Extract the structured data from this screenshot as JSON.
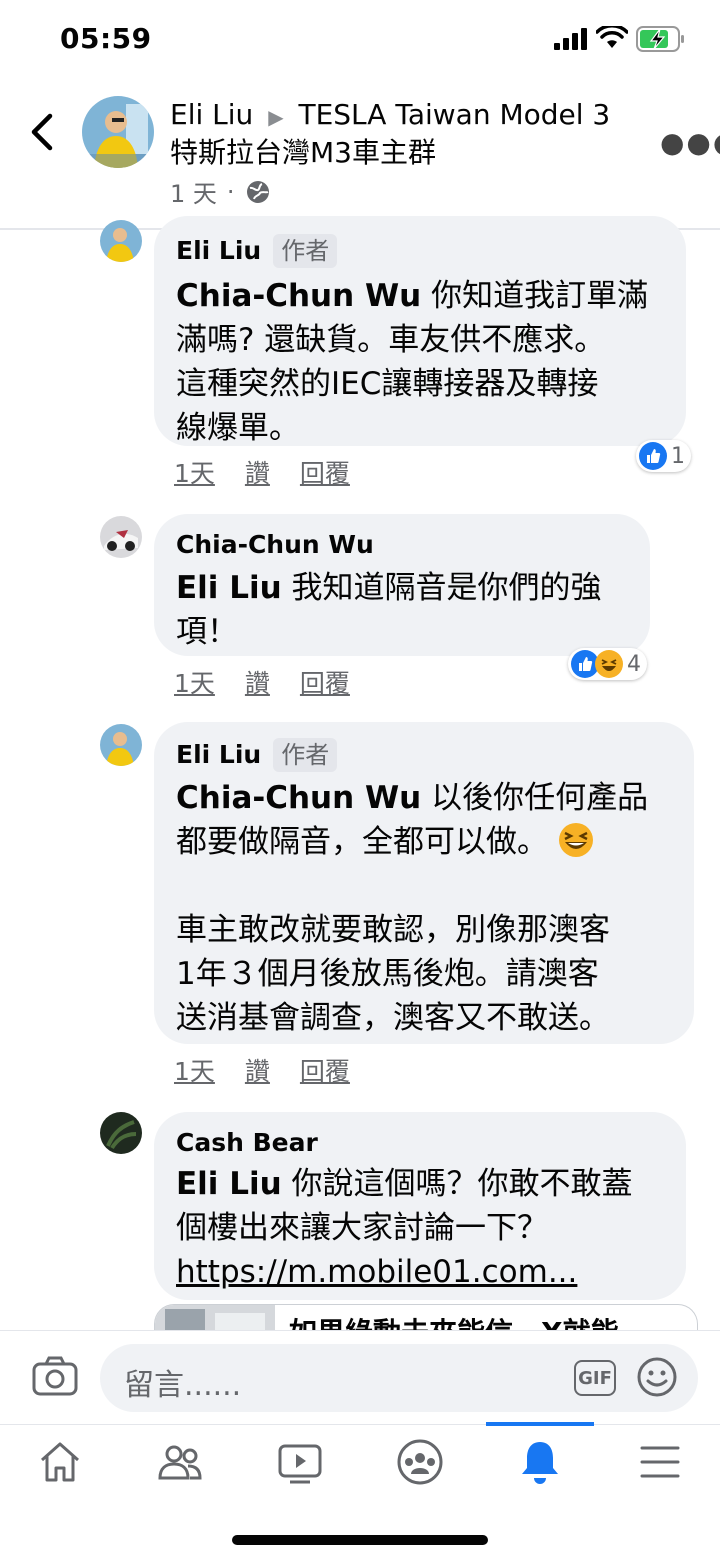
{
  "status_bar": {
    "time": "05:59"
  },
  "header": {
    "poster": "Eli Liu",
    "group_line1": "TESLA Taiwan Model 3",
    "group_line2": "特斯拉台灣M3車主群",
    "time": "1 天",
    "separator": "·"
  },
  "comments": [
    {
      "name": "Eli Liu",
      "badge": "作者",
      "mention": "Chia-Chun Wu",
      "text_l1": "你知道我訂單滿",
      "text_l2": "滿嗎? 還缺貨。車友供不應求。",
      "text_l3": "這種突然的IEC讓轉接器及轉接",
      "text_l4": "線爆單。",
      "time": "1天",
      "like": "讚",
      "reply": "回覆",
      "reaction_count": "1"
    },
    {
      "name": "Chia-Chun Wu",
      "mention": "Eli Liu",
      "text_l1": "我知道隔音是你們的強",
      "text_l2": "項！",
      "time": "1天",
      "like": "讚",
      "reply": "回覆",
      "reaction_count": "4"
    },
    {
      "name": "Eli Liu",
      "badge": "作者",
      "mention": "Chia-Chun Wu",
      "text_l1": "以後你任何產品",
      "text_l2": "都要做隔音，全都可以做。",
      "text_l3": "車主敢改就要敢認，別像那澳客",
      "text_l4": "1年３個月後放馬後炮。請澳客",
      "text_l5": "送消基會調查，澳客又不敢送。",
      "time": "1天",
      "like": "讚",
      "reply": "回覆"
    },
    {
      "name": "Cash Bear",
      "mention": "Eli Liu",
      "text_l1": "你說這個嗎？你敢不敢蓋",
      "text_l2": "個樓出來讓大家討論一下？",
      "link": "https://m.mobile01.com...",
      "preview_title": "如果綠動未來能信，X就能"
    }
  ],
  "composer": {
    "placeholder": "留言......",
    "gif": "GIF"
  },
  "colors": {
    "accent": "#1877f2",
    "bubble": "#f0f2f5",
    "secondary_text": "#65676b"
  }
}
